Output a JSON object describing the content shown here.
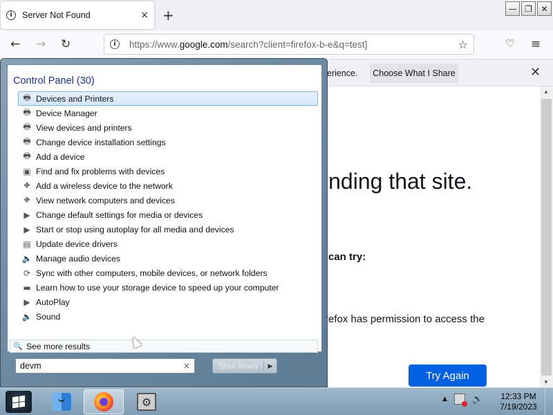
{
  "browser": {
    "tab_title": "Server Not Found",
    "tab_close": "×",
    "new_tab": "+",
    "url_prefix": "https://www.",
    "url_domain": "google.com",
    "url_suffix": "/search?client=firefox-b-e&q=test]",
    "window_buttons": [
      "—",
      "❐",
      "✕"
    ]
  },
  "page": {
    "notice_text": "erience.",
    "choose_button": "Choose What I Share",
    "notice_close": "✕",
    "heading": "inding that site.",
    "can_try": "can try:",
    "permission_text": "refox has permission to access the",
    "try_again": "Try Again"
  },
  "start_menu": {
    "group_title": "Control Panel (30)",
    "items": [
      {
        "label": "Devices and Printers",
        "icon": "printer-icon",
        "glyph": "🖶"
      },
      {
        "label": "Device Manager",
        "icon": "printer-icon",
        "glyph": "🖶"
      },
      {
        "label": "View devices and printers",
        "icon": "printer-icon",
        "glyph": "🖶"
      },
      {
        "label": "Change device installation settings",
        "icon": "printer-icon",
        "glyph": "🖶"
      },
      {
        "label": "Add a device",
        "icon": "printer-icon",
        "glyph": "🖶"
      },
      {
        "label": "Find and fix problems with devices",
        "icon": "window-icon",
        "glyph": "▣"
      },
      {
        "label": "Add a wireless device to the network",
        "icon": "network-icon",
        "glyph": "⛖"
      },
      {
        "label": "View network computers and devices",
        "icon": "network-icon",
        "glyph": "⛖"
      },
      {
        "label": "Change default settings for media or devices",
        "icon": "autoplay-icon",
        "glyph": "▶"
      },
      {
        "label": "Start or stop using autoplay for all media and devices",
        "icon": "autoplay-icon",
        "glyph": "▶"
      },
      {
        "label": "Update device drivers",
        "icon": "driver-icon",
        "glyph": "▤"
      },
      {
        "label": "Manage audio devices",
        "icon": "speaker-icon",
        "glyph": "🔈"
      },
      {
        "label": "Sync with other computers, mobile devices, or network folders",
        "icon": "sync-icon",
        "glyph": "⟳"
      },
      {
        "label": "Learn how to use your storage device to speed up your computer",
        "icon": "monitor-icon",
        "glyph": "▬"
      },
      {
        "label": "AutoPlay",
        "icon": "autoplay-icon",
        "glyph": "▶"
      },
      {
        "label": "Sound",
        "icon": "speaker-icon",
        "glyph": "🔈"
      }
    ],
    "see_more": "See more results",
    "search_value": "devm",
    "shutdown_label": "Shut down"
  },
  "taskbar": {
    "time": "12:33 PM",
    "date": "7/19/2023"
  },
  "colors": {
    "accent": "#0061e0",
    "selection": "#d4e6f9",
    "group_title": "#1e3287"
  }
}
